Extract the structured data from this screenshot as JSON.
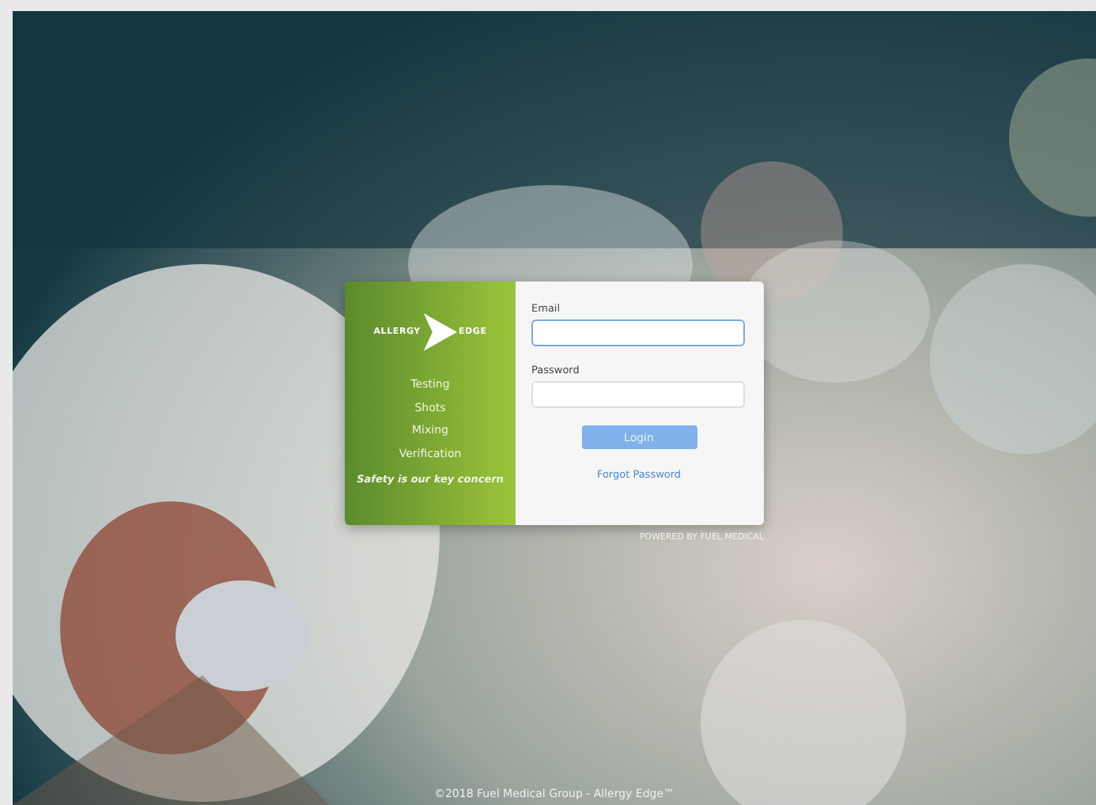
{
  "brand": {
    "logo_left": "ALLERGY",
    "logo_right": "EDGE"
  },
  "features": [
    "Testing",
    "Shots",
    "Mixing",
    "Verification"
  ],
  "tagline": "Safety is our key concern",
  "form": {
    "fields": [
      {
        "label": "Email",
        "focused": true
      },
      {
        "label": "Password",
        "focused": false
      }
    ],
    "login_button": "Login",
    "forgot_link": "Forgot Password"
  },
  "powered_by": "POWERED BY FUEL MEDICAL",
  "footer": "©2018 Fuel Medical Group - Allergy Edge™"
}
